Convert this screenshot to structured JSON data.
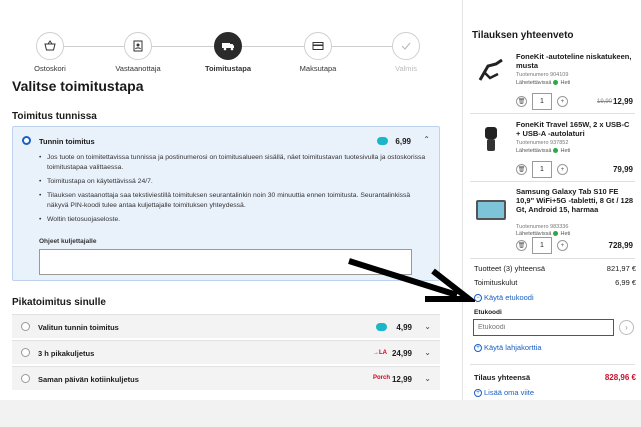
{
  "steps": [
    {
      "label": "Ostoskori"
    },
    {
      "label": "Vastaanottaja"
    },
    {
      "label": "Toimitustapa"
    },
    {
      "label": "Maksutapa"
    },
    {
      "label": "Valmis"
    }
  ],
  "page_title": "Valitse toimitustapa",
  "section1": {
    "heading": "Toimitus tunnissa",
    "selected_option": {
      "title": "Tunnin toimitus",
      "price": "6,99",
      "bullets": [
        "Jos tuote on toimitettavissa tunnissa ja postinumerosi on toimitusalueen sisällä, näet toimitustavan tuotesivulla ja ostoskorissa toimitustapaa valittaessa.",
        "Toimitustapa on käytettävissä 24/7.",
        "Tilauksen vastaanottaja saa tekstiviestillä toimituksen seurantalinkin noin 30 minuuttia ennen toimitusta. Seurantalinkissä näkyvä PIN-koodi tulee antaa kuljettajalle toimituksen yhteydessä.",
        "Woltin tietosuojaseloste."
      ],
      "note_label": "Ohjeet kuljettajalle"
    }
  },
  "section2": {
    "heading": "Pikatoimitus sinulle",
    "options": [
      {
        "title": "Valitun tunnin toimitus",
        "price": "4,99",
        "brand": "teal"
      },
      {
        "title": "3 h pikakuljetus",
        "price": "24,99",
        "brand": "red",
        "brand_text": "→LA"
      },
      {
        "title": "Saman päivän kotiinkuljetus",
        "price": "12,99",
        "brand": "red",
        "brand_text": "Porch"
      }
    ]
  },
  "summary": {
    "title": "Tilauksen yhteenveto",
    "items": [
      {
        "name": "FoneKit -autoteline niskatukeen, musta",
        "sku": "Tuotenumero 904109",
        "stock": "Lähetettävissä",
        "stock_status": "Heti",
        "qty": "1",
        "old_price": "19,90",
        "price": "12,99"
      },
      {
        "name": "FoneKit Travel 165W, 2 x USB-C + USB-A -autolaturi",
        "sku": "Tuotenumero 937852",
        "stock": "Lähetettävissä",
        "stock_status": "Heti",
        "qty": "1",
        "old_price": "",
        "price": "79,99"
      },
      {
        "name": "Samsung Galaxy Tab S10 FE 10,9\" WiFi+5G -tabletti, 8 Gt / 128 Gt, Android 15, harmaa",
        "sku": "Tuotenumero 983336",
        "stock": "Lähetettävissä",
        "stock_status": "Heti",
        "qty": "1",
        "old_price": "",
        "price": "728,99"
      }
    ],
    "products_label": "Tuotteet (3) yhteensä",
    "products_value": "821,97 €",
    "shipping_label": "Toimituskulut",
    "shipping_value": "6,99 €",
    "use_code_link": "Käytä etukoodi",
    "code_label": "Etukoodi",
    "code_placeholder": "Etukoodi",
    "gift_card_link": "Käytä lahjakorttia",
    "total_label": "Tilaus yhteensä",
    "total_value": "828,96 €",
    "add_ref_link": "Lisää oma viite"
  },
  "colors": {
    "accent": "#1b5fc2",
    "total_red": "#c8102e",
    "selected_bg": "#e9f1fb"
  }
}
